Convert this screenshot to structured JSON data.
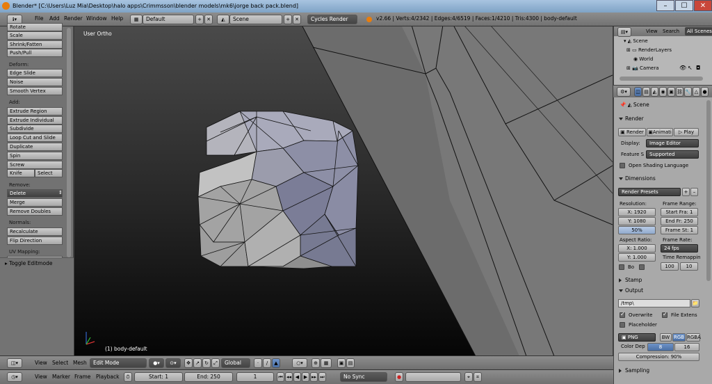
{
  "window": {
    "title": "Blender* [C:\\Users\\Luz Mia\\Desktop\\halo apps\\Crimmsson\\blender models\\mk6\\jorge back pack.blend]",
    "min": "–",
    "max": "☐",
    "close": "✕"
  },
  "topbar": {
    "menus": [
      "File",
      "Add",
      "Render",
      "Window",
      "Help"
    ],
    "layout": "Default",
    "scene": "Scene",
    "engine": "Cycles Render",
    "stats": "v2.66 | Verts:4/2342 | Edges:4/6519 | Faces:1/4210 | Tris:4300 | body-default"
  },
  "toolshelf": {
    "buttons_top": [
      "Rotate",
      "Scale",
      "Shrink/Fatten",
      "Push/Pull"
    ],
    "deform_head": "Deform:",
    "deform": [
      "Edge Slide",
      "Noise",
      "Smooth Vertex"
    ],
    "add_head": "Add:",
    "add": [
      "Extrude Region",
      "Extrude Individual",
      "Subdivide",
      "Loop Cut and Slide",
      "Duplicate",
      "Spin",
      "Screw"
    ],
    "knife": "Knife",
    "select": "Select",
    "remove_head": "Remove:",
    "delete": "Delete",
    "merge": "Merge",
    "remove_doubles": "Remove Doubles",
    "normals_head": "Normals:",
    "recalculate": "Recalculate",
    "flip_direction": "Flip Direction",
    "uv_head": "UV Mapping:",
    "toggle_editmode": "Toggle Editmode"
  },
  "viewport": {
    "view_label": "User Ortho",
    "object_label": "(1) body-default"
  },
  "view3d_header": {
    "menus": [
      "View",
      "Select",
      "Mesh"
    ],
    "mode": "Edit Mode",
    "orientation": "Global"
  },
  "timeline": {
    "menus": [
      "View",
      "Marker",
      "Frame",
      "Playback"
    ],
    "start": "Start: 1",
    "end": "End: 250",
    "current": "1",
    "sync": "No Sync"
  },
  "outliner": {
    "menus": [
      "View",
      "Search"
    ],
    "filter": "All Scenes",
    "items": [
      "Scene",
      "RenderLayers",
      "World",
      "Camera"
    ]
  },
  "props": {
    "context": "Scene",
    "render_section": "Render",
    "render_btn": "Render",
    "anim_btn": "Animati",
    "play_btn": "Play",
    "display_label": "Display:",
    "display_value": "Image Editor",
    "feature_label": "Feature S",
    "feature_value": "Supported",
    "osl": "Open Shading Language",
    "dimensions_section": "Dimensions",
    "render_presets": "Render Presets",
    "resolution_label": "Resolution:",
    "res_x": "X: 1920",
    "res_y": "Y: 1080",
    "res_pct": "50%",
    "frame_range_label": "Frame Range:",
    "start_fra": "Start Fra: 1",
    "end_fr": "End Fr: 250",
    "frame_st": "Frame St: 1",
    "aspect_label": "Aspect Ratio:",
    "asp_x": "X: 1.000",
    "asp_y": "Y: 1.000",
    "frame_rate_label": "Frame Rate:",
    "fps": "24 fps",
    "bo": "Bo",
    "time_remap": "Time Remappin",
    "remap_old": "100",
    "remap_new": "10",
    "stamp_section": "Stamp",
    "output_section": "Output",
    "output_path": "/tmp\\",
    "overwrite": "Overwrite",
    "file_ext": "File Extens",
    "placeholder": "Placeholder",
    "format": "PNG",
    "bw": "BW",
    "rgb": "RGB",
    "rgba": "RGBA",
    "color_depth_label": "Color Dep",
    "depth8": "8",
    "depth16": "16",
    "compression": "Compression: 90%",
    "sampling_section": "Sampling"
  },
  "colors": {
    "ui_gray": "#727272",
    "mesh_face": "#8f91a8",
    "selected_blue": "#5680c2"
  }
}
